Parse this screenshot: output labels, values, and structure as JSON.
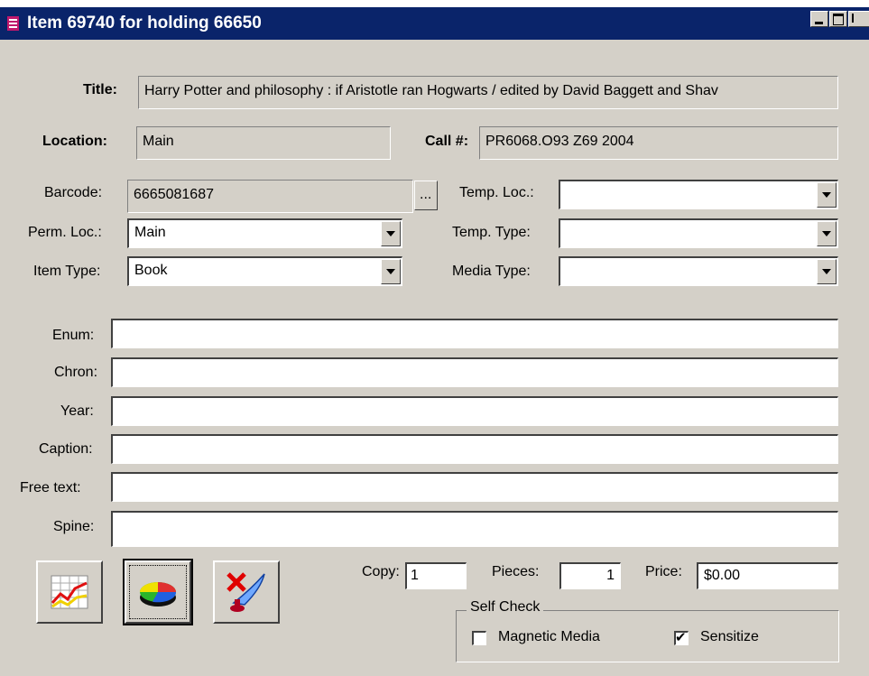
{
  "window": {
    "title": "Item 69740 for holding 66650",
    "controls": [
      "minimize-icon",
      "maximize-icon",
      "close-icon"
    ]
  },
  "header": {
    "title_label": "Title:",
    "title_value": "Harry Potter and philosophy : if Aristotle ran Hogwarts / edited by David Baggett and Shav",
    "location_label": "Location:",
    "location_value": "Main",
    "call_label": "Call #:",
    "call_value": "PR6068.O93 Z69 2004"
  },
  "fields": {
    "barcode": {
      "label": "Barcode:",
      "value": "6665081687",
      "browse": "..."
    },
    "perm_loc": {
      "label": "Perm. Loc.:",
      "value": "Main"
    },
    "item_type": {
      "label": "Item Type:",
      "value": "Book"
    },
    "temp_loc": {
      "label": "Temp. Loc.:",
      "value": ""
    },
    "temp_type": {
      "label": "Temp. Type:",
      "value": ""
    },
    "media_type": {
      "label": "Media Type:",
      "value": ""
    }
  },
  "text_fields": [
    {
      "label": "Enum:",
      "value": ""
    },
    {
      "label": "Chron:",
      "value": ""
    },
    {
      "label": "Year:",
      "value": ""
    },
    {
      "label": "Caption:",
      "value": ""
    },
    {
      "label": "Free text:",
      "value": ""
    },
    {
      "label": "Spine:",
      "value": ""
    }
  ],
  "toolbar": {
    "buttons": [
      "chart-icon",
      "pie-chart-icon",
      "delete-icon"
    ]
  },
  "counts": {
    "copy_label": "Copy:",
    "copy_value": "1",
    "pieces_label": "Pieces:",
    "pieces_value": "1",
    "price_label": "Price:",
    "price_value": "$0.00"
  },
  "self_check": {
    "legend": "Self Check",
    "magnetic_label": "Magnetic Media",
    "magnetic_checked": false,
    "sensitize_label": "Sensitize",
    "sensitize_checked": true,
    "check_glyph": "✔"
  },
  "colors": {
    "titlebar": "#0a246a",
    "face": "#d4d0c8",
    "field": "#ffffff"
  }
}
